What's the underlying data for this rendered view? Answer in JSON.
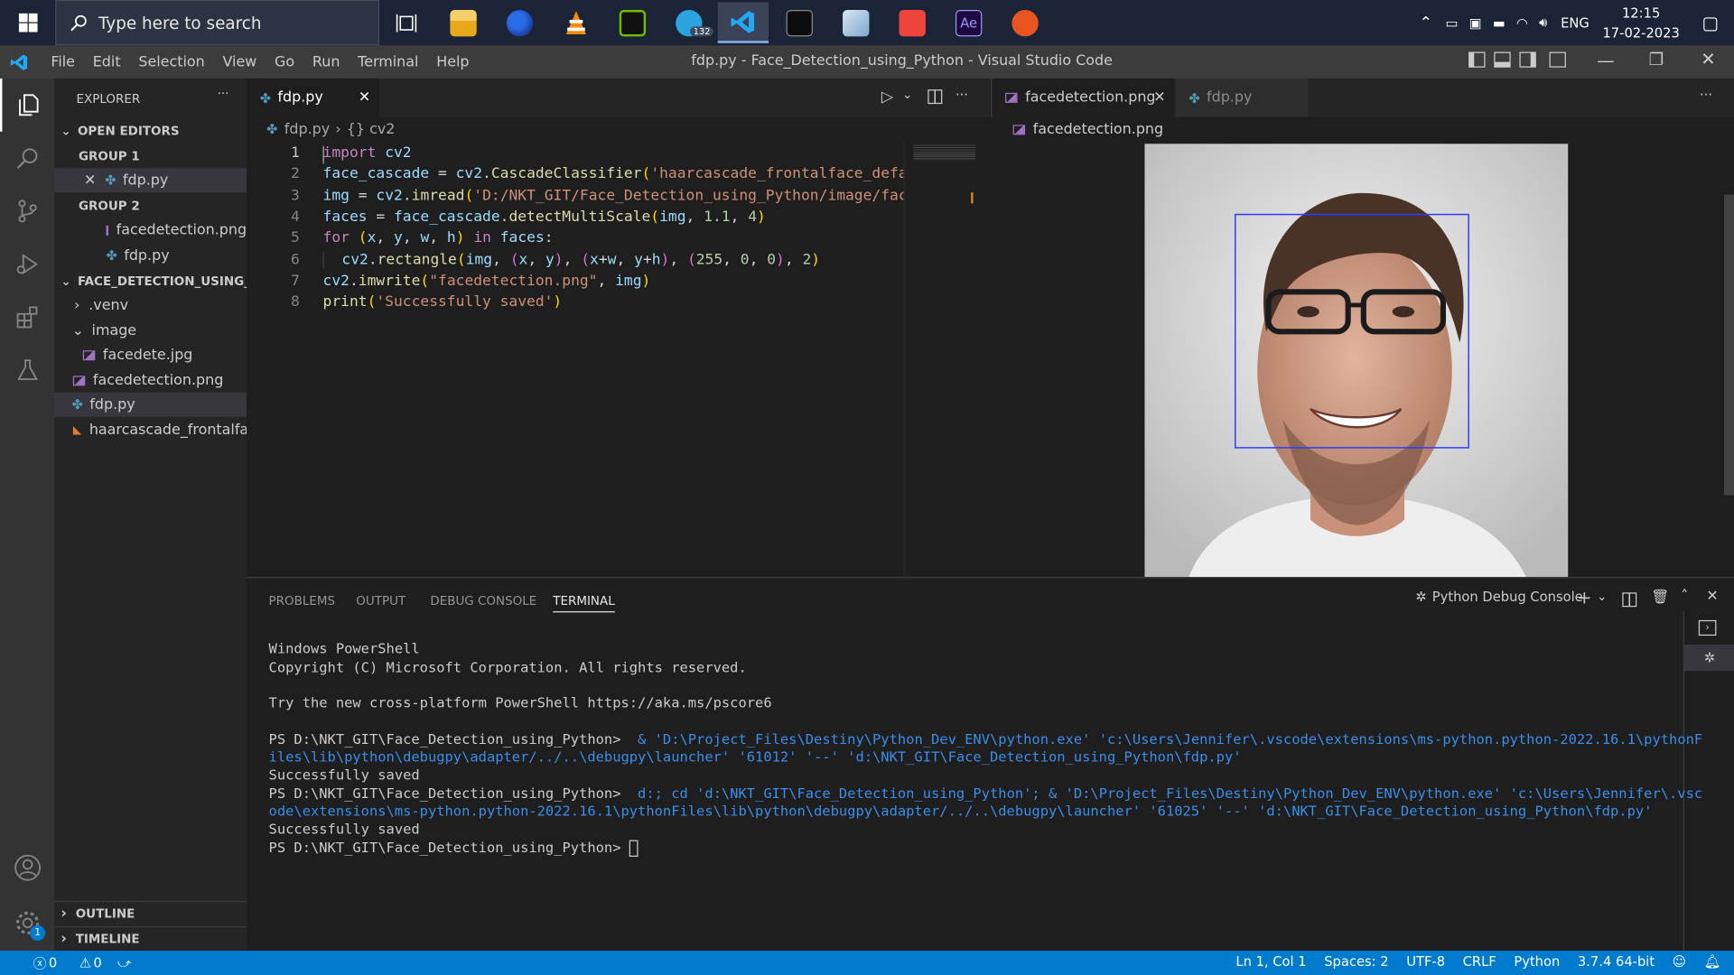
{
  "taskbar": {
    "search_placeholder": "Type here to search",
    "apps": [
      "task-view",
      "file-explorer",
      "firefox",
      "vlc",
      "nvidia",
      "telegram",
      "vscode",
      "terminal",
      "control-panel",
      "anydesk",
      "after-effects",
      "ubuntu"
    ],
    "telegram_badge": "132",
    "ae_label": "Ae",
    "tray": {
      "lang": "ENG",
      "time": "12:15",
      "date": "17-02-2023"
    }
  },
  "titlebar": {
    "menu": [
      "File",
      "Edit",
      "Selection",
      "View",
      "Go",
      "Run",
      "Terminal",
      "Help"
    ],
    "title": "fdp.py - Face_Detection_using_Python - Visual Studio Code"
  },
  "explorer": {
    "title": "EXPLORER",
    "open_editors": "OPEN EDITORS",
    "group1": "GROUP 1",
    "group1_file": "fdp.py",
    "group2": "GROUP 2",
    "group2_files": [
      "facedetection.png",
      "fdp.py"
    ],
    "project": "FACE_DETECTION_USING_...",
    "tree": {
      "venv": ".venv",
      "image": "image",
      "image_file": "facedete.jpg",
      "png": "facedetection.png",
      "py": "fdp.py",
      "xml": "haarcascade_frontalfa..."
    },
    "outline": "OUTLINE",
    "timeline": "TIMELINE"
  },
  "editor1": {
    "tab": "fdp.py",
    "breadcrumb_file": "fdp.py",
    "breadcrumb_symbol": "{} cv2",
    "line_numbers": [
      "1",
      "2",
      "3",
      "4",
      "5",
      "6",
      "7",
      "8"
    ]
  },
  "editor2": {
    "tabs": [
      "facedetection.png",
      "fdp.py"
    ],
    "breadcrumb": "facedetection.png"
  },
  "panel": {
    "tabs": [
      "PROBLEMS",
      "OUTPUT",
      "DEBUG CONSOLE",
      "TERMINAL"
    ],
    "terminal_name": "Python Debug Console",
    "lines": {
      "l1": "Windows PowerShell",
      "l2": "Copyright (C) Microsoft Corporation. All rights reserved.",
      "l3": "Try the new cross-platform PowerShell https://aka.ms/pscore6",
      "prompt": "PS D:\\NKT_GIT\\Face_Detection_using_Python>",
      "cmd1a": "  & 'D:\\Project_Files\\Destiny\\Python_Dev_ENV\\python.exe' 'c:\\Users\\Jennifer\\.vscode\\extensions\\ms-python.python-2022.16.1\\pythonF",
      "cmd1b": "iles\\lib\\python\\debugpy\\adapter/../..\\debugpy\\launcher' '61012' '--' 'd:\\NKT_GIT\\Face_Detection_using_Python\\fdp.py'",
      "saved": "Successfully saved",
      "cmd2a": "  d:; cd 'd:\\NKT_GIT\\Face_Detection_using_Python'; & 'D:\\Project_Files\\Destiny\\Python_Dev_ENV\\python.exe' 'c:\\Users\\Jennifer\\.vsc",
      "cmd2b": "ode\\extensions\\ms-python.python-2022.16.1\\pythonFiles\\lib\\python\\debugpy\\adapter/../..\\debugpy\\launcher' '61025' '--' 'd:\\NKT_GIT\\Face_Detection_using_Python\\fdp.py'"
    }
  },
  "statusbar": {
    "errors": "0",
    "warnings": "0",
    "position": "Ln 1, Col 1",
    "spaces": "Spaces: 2",
    "encoding": "UTF-8",
    "eol": "CRLF",
    "language": "Python",
    "interpreter": "3.7.4 64-bit"
  },
  "activity_badge": "1",
  "colors": {
    "accent": "#007acc",
    "titlebar": "#3c3c3c",
    "sidebar": "#252526",
    "editor": "#1e1e1e"
  }
}
